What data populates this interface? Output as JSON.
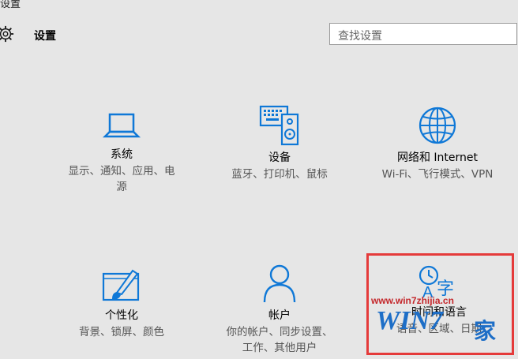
{
  "window": {
    "title": "设置"
  },
  "header": {
    "title": "设置",
    "icon": "gear-icon"
  },
  "search": {
    "placeholder": "查找设置"
  },
  "tiles": [
    {
      "name": "系统",
      "desc_lines": [
        "显示、通知、应用、电",
        "源"
      ],
      "icon": "laptop-icon"
    },
    {
      "name": "设备",
      "desc_lines": [
        "蓝牙、打印机、鼠标"
      ],
      "icon": "keyboard-speaker-icon"
    },
    {
      "name": "网络和 Internet",
      "desc_lines": [
        "Wi-Fi、飞行模式、VPN"
      ],
      "icon": "globe-icon"
    },
    {
      "name": "个性化",
      "desc_lines": [
        "背景、锁屏、颜色"
      ],
      "icon": "paint-brush-icon"
    },
    {
      "name": "帐户",
      "desc_lines": [
        "你的帐户、同步设置、",
        "工作、其他用户"
      ],
      "icon": "person-icon"
    },
    {
      "name": "时间和语言",
      "desc_lines": [
        "语音、区域、日期"
      ],
      "icon": "time-language-icon"
    }
  ],
  "watermark": {
    "url": "www.win7zhijia.cn",
    "logo": "WIN7",
    "suffix": "家"
  },
  "colors": {
    "accent": "#0f78d7",
    "highlight": "#e53b3b",
    "background": "#e6e6e6"
  }
}
